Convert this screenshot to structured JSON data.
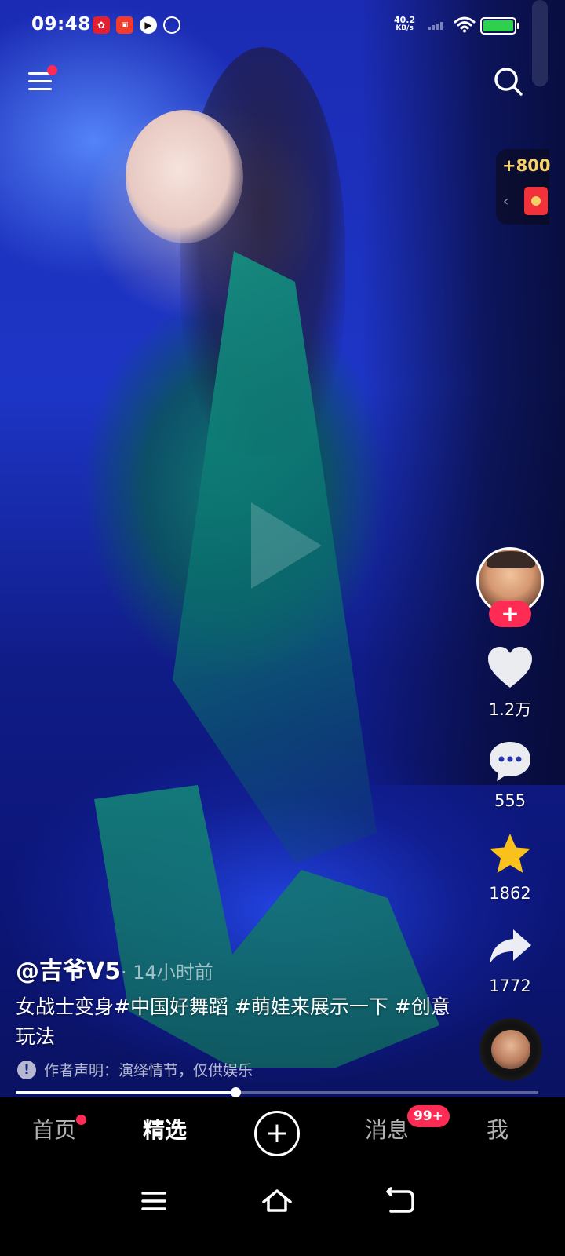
{
  "status_bar": {
    "time": "09:48",
    "net_speed_value": "40.2",
    "net_speed_unit": "KB/s",
    "battery_level": 1.0,
    "notification_icons": [
      "app-icon-red",
      "app-icon-video",
      "app-icon-play",
      "link-icon"
    ]
  },
  "top": {
    "menu_icon": "menu-icon",
    "search_icon": "search-icon",
    "coins": "+800",
    "red_packet_icon": "red-packet-icon"
  },
  "post": {
    "author": "@吉爷V5",
    "time_ago": "· 14小时前",
    "caption": "女战士变身#中国好舞蹈 #萌娃来展示一下 #创意玩法",
    "disclaimer": "作者声明：演绎情节，仅供娱乐",
    "progress": 0.42
  },
  "actions": {
    "follow": "+",
    "likes": "1.2万",
    "comments": "555",
    "favorites": "1862",
    "shares": "1772"
  },
  "tabbar": {
    "home": "首页",
    "featured": "精选",
    "create": "+",
    "messages": "消息",
    "messages_badge": "99+",
    "me": "我"
  },
  "colors": {
    "accent": "#fe2c55",
    "coin": "#f8d268",
    "battery": "#2fd04d"
  }
}
